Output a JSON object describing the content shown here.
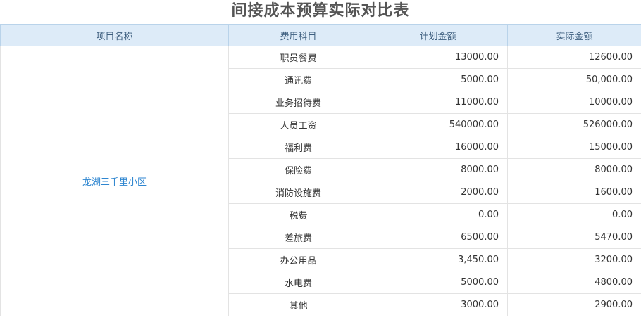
{
  "report": {
    "title": "间接成本预算实际对比表",
    "columns": {
      "project": "项目名称",
      "subject": "费用科目",
      "planned": "计划金额",
      "actual": "实际金额"
    },
    "project_name": "龙湖三千里小区",
    "rows": [
      {
        "subject": "职员餐费",
        "planned": "13000.00",
        "actual": "12600.00"
      },
      {
        "subject": "通讯费",
        "planned": "5000.00",
        "actual": "50,000.00"
      },
      {
        "subject": "业务招待费",
        "planned": "11000.00",
        "actual": "10000.00"
      },
      {
        "subject": "人员工资",
        "planned": "540000.00",
        "actual": "526000.00"
      },
      {
        "subject": "福利费",
        "planned": "16000.00",
        "actual": "15000.00"
      },
      {
        "subject": "保险费",
        "planned": "8000.00",
        "actual": "8000.00"
      },
      {
        "subject": "消防设施费",
        "planned": "2000.00",
        "actual": "1600.00"
      },
      {
        "subject": "税费",
        "planned": "0.00",
        "actual": "0.00"
      },
      {
        "subject": "差旅费",
        "planned": "6500.00",
        "actual": "5470.00"
      },
      {
        "subject": "办公用品",
        "planned": "3,450.00",
        "actual": "3200.00"
      },
      {
        "subject": "水电费",
        "planned": "5000.00",
        "actual": "4800.00"
      },
      {
        "subject": "其他",
        "planned": "3000.00",
        "actual": "2900.00"
      }
    ]
  }
}
